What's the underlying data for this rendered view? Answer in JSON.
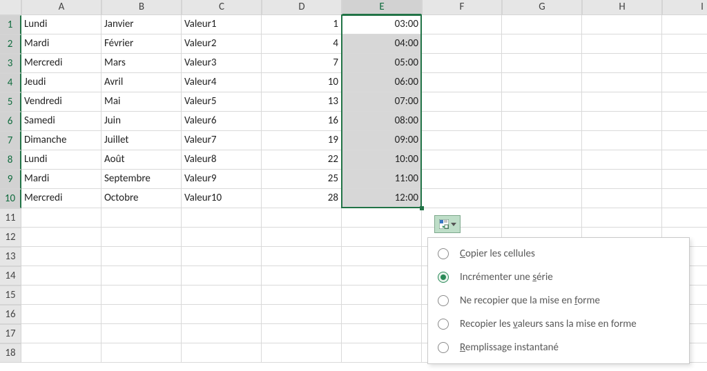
{
  "columns": [
    "A",
    "B",
    "C",
    "D",
    "E",
    "F",
    "G",
    "H",
    "I"
  ],
  "active_column_index": 4,
  "row_count": 18,
  "active_row_start": 1,
  "active_row_end": 10,
  "rows": [
    {
      "a": "Lundi",
      "b": "Janvier",
      "c": "Valeur1",
      "d": "1",
      "e": "03:00"
    },
    {
      "a": "Mardi",
      "b": "Février",
      "c": "Valeur2",
      "d": "4",
      "e": "04:00"
    },
    {
      "a": "Mercredi",
      "b": "Mars",
      "c": "Valeur3",
      "d": "7",
      "e": "05:00"
    },
    {
      "a": "Jeudi",
      "b": "Avril",
      "c": "Valeur4",
      "d": "10",
      "e": "06:00"
    },
    {
      "a": "Vendredi",
      "b": "Mai",
      "c": "Valeur5",
      "d": "13",
      "e": "07:00"
    },
    {
      "a": "Samedi",
      "b": "Juin",
      "c": "Valeur6",
      "d": "16",
      "e": "08:00"
    },
    {
      "a": "Dimanche",
      "b": "Juillet",
      "c": "Valeur7",
      "d": "19",
      "e": "09:00"
    },
    {
      "a": "Lundi",
      "b": "Août",
      "c": "Valeur8",
      "d": "22",
      "e": "10:00"
    },
    {
      "a": "Mardi",
      "b": "Septembre",
      "c": "Valeur9",
      "d": "25",
      "e": "11:00"
    },
    {
      "a": "Mercredi",
      "b": "Octobre",
      "c": "Valeur10",
      "d": "28",
      "e": "12:00"
    }
  ],
  "autofill_menu": {
    "items": [
      {
        "label_pre": "",
        "mn": "C",
        "label_post": "opier les cellules",
        "selected": false
      },
      {
        "label_pre": "Incrémenter une ",
        "mn": "s",
        "label_post": "érie",
        "selected": true
      },
      {
        "label_pre": "Ne recopier que la mise en ",
        "mn": "f",
        "label_post": "orme",
        "selected": false
      },
      {
        "label_pre": "Recopier les ",
        "mn": "v",
        "label_post": "aleurs sans la mise en forme",
        "selected": false
      },
      {
        "label_pre": "",
        "mn": "R",
        "label_post": "emplissage instantané",
        "selected": false
      }
    ]
  }
}
